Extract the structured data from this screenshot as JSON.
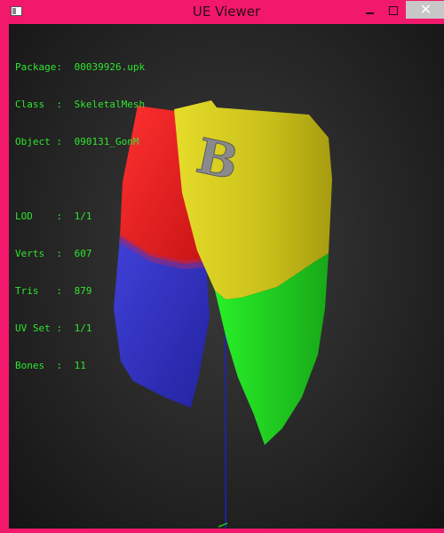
{
  "window": {
    "title": "UE Viewer",
    "controls": {
      "minimize": "minimize",
      "maximize": "maximize",
      "close": "✕"
    }
  },
  "info": {
    "package_key": "Package:",
    "package_val": "00039926.upk",
    "class_key": "Class  :",
    "class_val": "SkeletalMesh",
    "object_key": "Object :",
    "object_val": "090131_GonM",
    "lod_key": "LOD    :",
    "lod_val": "1/1",
    "verts_key": "Verts  :",
    "verts_val": "607",
    "tris_key": "Tris   :",
    "tris_val": "879",
    "uvset_key": "UV Set :",
    "uvset_val": "1/1",
    "bones_key": "Bones  :",
    "bones_val": "11"
  },
  "mesh": {
    "letter": "B",
    "colors": {
      "red": "#ff2020",
      "blue": "#3a3ad0",
      "yellow": "#d8cc20",
      "green": "#22e020",
      "letter": "#8c8c8c"
    }
  }
}
